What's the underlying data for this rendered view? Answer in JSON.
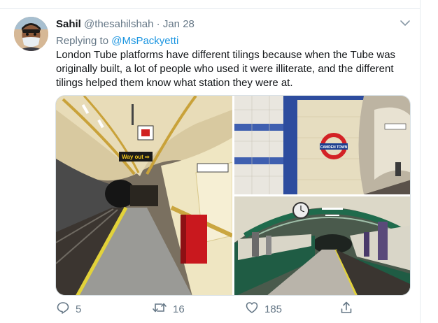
{
  "tweet": {
    "display_name": "Sahil",
    "handle": "@thesahilshah",
    "separator": "·",
    "date": "Jan 28",
    "replying_label": "Replying to",
    "replying_to": "@MsPackyetti",
    "text": "London Tube platforms have different tilings because when the Tube was originally built, a lot of people who used it were illiterate, and the different tilings helped them know what station they were at."
  },
  "photos": {
    "left_sign": "Way out ⇨",
    "top_right_sign": "CAMDEN TOWN"
  },
  "actions": {
    "reply_count": "5",
    "retweet_count": "16",
    "like_count": "185"
  },
  "icons": {
    "more": "chevron-down-icon",
    "reply": "reply-icon",
    "retweet": "retweet-icon",
    "like": "heart-icon",
    "share": "share-icon"
  },
  "colors": {
    "link": "#1b95e0",
    "muted": "#657786",
    "text": "#14171a",
    "border": "#e6ecf0"
  }
}
